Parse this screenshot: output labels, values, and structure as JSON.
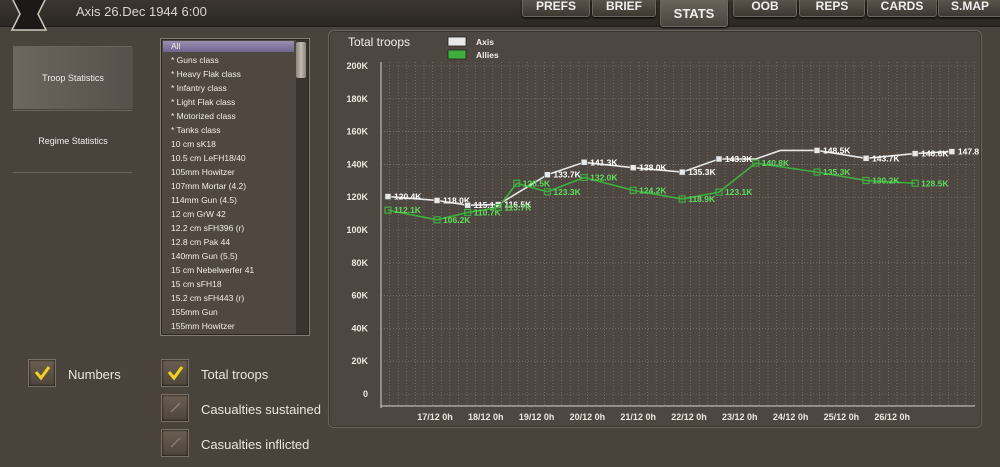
{
  "window": {
    "title": "Axis 26.Dec 1944 6:00"
  },
  "tabs": [
    {
      "label": "PREFS"
    },
    {
      "label": "BRIEF"
    },
    {
      "label": "STATS"
    },
    {
      "label": "OOB"
    },
    {
      "label": "REPS"
    },
    {
      "label": "CARDS"
    },
    {
      "label": "S.MAP"
    }
  ],
  "active_tab": "STATS",
  "sidebar": {
    "items": [
      {
        "label": "Troop Statistics",
        "selected": true
      },
      {
        "label": "Regime Statistics",
        "selected": false
      }
    ]
  },
  "class_list": {
    "selected": "All",
    "items": [
      "All",
      "* Guns class",
      "* Heavy Flak class",
      "* Infantry class",
      "* Light Flak class",
      "* Motorized class",
      "* Tanks class",
      "10 cm sK18",
      "10.5 cm LeFH18/40",
      "105mm Howitzer",
      "107mm Mortar (4.2)",
      "114mm Gun (4.5)",
      "12 cm GrW 42",
      "12.2 cm sFH396 (r)",
      "12.8 cm Pak 44",
      "140mm Gun (5.5)",
      "15 cm Nebelwerfer 41",
      "15 cm sFH18",
      "15.2 cm sFH443 (r)",
      "155mm Gun",
      "155mm Howitzer"
    ]
  },
  "options": {
    "numbers": {
      "label": "Numbers",
      "checked": true
    },
    "total_troops": {
      "label": "Total troops",
      "checked": true
    },
    "casualties_sustained": {
      "label": "Casualties sustained",
      "checked": false
    },
    "casualties_inflicted": {
      "label": "Casualties inflicted",
      "checked": false
    }
  },
  "colors": {
    "axis_series": "#e8e8e8",
    "allies_series": "#3fae3f",
    "allies_label": "#5ddc5d",
    "grid": "#8a8178"
  },
  "chart_data": {
    "type": "line",
    "title": "Total troops",
    "legend_position": "top-left",
    "grid": true,
    "y_ticks": [
      "0",
      "20K",
      "40K",
      "60K",
      "80K",
      "100K",
      "120K",
      "140K",
      "160K",
      "180K",
      "200K"
    ],
    "ylim": [
      0,
      200
    ],
    "x_tick_labels": [
      "17/12 0h",
      "18/12 0h",
      "19/12 0h",
      "20/12 0h",
      "21/12 0h",
      "22/12 0h",
      "23/12 0h",
      "24/12 0h",
      "25/12 0h",
      "26/12 0h"
    ],
    "xlim": [
      0,
      18.6
    ],
    "series": [
      {
        "name": "Axis",
        "points": [
          {
            "x": 0,
            "y": 120.4,
            "label": "120.4K"
          },
          {
            "x": 1.6,
            "y": 118.0,
            "label": "118.0K"
          },
          {
            "x": 2.6,
            "y": 115.1,
            "label": "115.1K"
          },
          {
            "x": 3.6,
            "y": 115.5,
            "label": "116.5K"
          },
          {
            "x": 5.2,
            "y": 133.7,
            "label": "133.7K"
          },
          {
            "x": 6.4,
            "y": 141.3,
            "label": "141.3K"
          },
          {
            "x": 8.0,
            "y": 138.0,
            "label": "138.0K"
          },
          {
            "x": 9.6,
            "y": 135.3,
            "label": "135.3K"
          },
          {
            "x": 10.8,
            "y": 143.3,
            "label": "143.3K"
          },
          {
            "x": 12.0,
            "y": 143.3
          },
          {
            "x": 12.8,
            "y": 148.5
          },
          {
            "x": 14.0,
            "y": 148.5,
            "label": "148.5K"
          },
          {
            "x": 15.6,
            "y": 143.7,
            "label": "143.7K"
          },
          {
            "x": 17.2,
            "y": 146.6,
            "label": "146.6K"
          },
          {
            "x": 18.4,
            "y": 147.8,
            "label": "147.8"
          }
        ]
      },
      {
        "name": "Allies",
        "points": [
          {
            "x": 0,
            "y": 112.1,
            "label": "112.1K"
          },
          {
            "x": 1.6,
            "y": 106.2,
            "label": "106.2K"
          },
          {
            "x": 2.6,
            "y": 110.7,
            "label": "110.7K"
          },
          {
            "x": 3.6,
            "y": 113.7,
            "label": "113.7K"
          },
          {
            "x": 4.2,
            "y": 128.5,
            "label": "128.5K"
          },
          {
            "x": 5.2,
            "y": 123.3,
            "label": "123.3K"
          },
          {
            "x": 6.4,
            "y": 132.0,
            "label": "132.0K"
          },
          {
            "x": 8.0,
            "y": 124.2,
            "label": "124.2K"
          },
          {
            "x": 9.6,
            "y": 118.9,
            "label": "118.9K"
          },
          {
            "x": 10.8,
            "y": 123.1,
            "label": "123.1K"
          },
          {
            "x": 12.0,
            "y": 140.8,
            "label": "140.8K"
          },
          {
            "x": 14.0,
            "y": 135.3,
            "label": "135.3K"
          },
          {
            "x": 15.6,
            "y": 130.2,
            "label": "130.2K"
          },
          {
            "x": 17.2,
            "y": 128.5,
            "label": "128.5K"
          }
        ]
      }
    ]
  }
}
